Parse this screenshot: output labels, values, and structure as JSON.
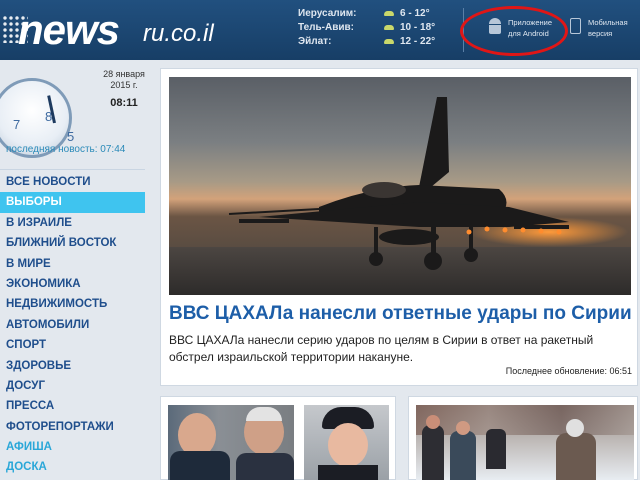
{
  "header": {
    "logo": {
      "news": "news",
      "domain": "ru.co.il"
    },
    "weather": [
      {
        "city": "Иерусалим:",
        "temp": "6 - 12°",
        "icon": "cloud-icon"
      },
      {
        "city": "Тель-Авив:",
        "temp": "10 - 18°",
        "icon": "cloud-icon"
      },
      {
        "city": "Эйлат:",
        "temp": "12 - 22°",
        "icon": "cloud-icon"
      }
    ],
    "app": {
      "line1": "Приложение",
      "line2": "для Android",
      "icon": "android-icon"
    },
    "mobile": {
      "line1": "Мобильная",
      "line2": "версия",
      "icon": "phone-icon"
    },
    "highlight_color": "#e01616"
  },
  "sidebar": {
    "clock": {
      "numbers": [
        "7",
        "8",
        "5"
      ]
    },
    "date_line1": "28 января",
    "date_line2": "2015 г.",
    "time": "08:11",
    "last_news": "последняя новость: 07:44",
    "menu": [
      {
        "label": "ВСЕ НОВОСТИ"
      },
      {
        "label": "ВЫБОРЫ",
        "active": true
      },
      {
        "label": "В ИЗРАИЛЕ"
      },
      {
        "label": "БЛИЖНИЙ ВОСТОК"
      },
      {
        "label": "В МИРЕ"
      },
      {
        "label": "ЭКОНОМИКА"
      },
      {
        "label": "НЕДВИЖИМОСТЬ"
      },
      {
        "label": "АВТОМОБИЛИ"
      },
      {
        "label": "СПОРТ"
      },
      {
        "label": "ЗДОРОВЬЕ"
      },
      {
        "label": "ДОСУГ"
      },
      {
        "label": "ПРЕССА"
      },
      {
        "label": "ФОТОРЕПОРТАЖИ"
      },
      {
        "label": "АФИША",
        "light": true
      },
      {
        "label": "ДОСКА",
        "light": true
      }
    ],
    "active_color": "#3fc4ef"
  },
  "main": {
    "headline": "ВВС ЦАХАЛа нанесли ответные удары по Сирии",
    "lead": "ВВС ЦАХАЛа нанесли серию ударов по целям в Сирии в ответ на ракетный обстрел израильской территории накануне.",
    "updated": "Последнее обновление: 06:51",
    "headline_color": "#1d5ea8"
  }
}
